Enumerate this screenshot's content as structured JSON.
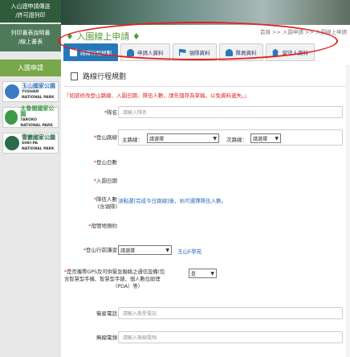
{
  "sidebar": {
    "top_links": [
      "入山證申請傳送",
      "/許可證列印"
    ],
    "links": [
      "列印書表說明書",
      "/線上書表"
    ],
    "apply_label": "入園申請",
    "parks": [
      {
        "zh": "玉山國家公園",
        "en1": "YUSHAN",
        "en2": "NATIONAL PARK",
        "color": "#3d7ac4"
      },
      {
        "zh": "太魯閣國家公園",
        "en1": "TAROKO",
        "en2": "NATIONAL PARK",
        "color": "#3c9a4a"
      },
      {
        "zh": "雪霸國家公園",
        "en1": "SHEI-PA",
        "en2": "NATIONAL PARK",
        "color": "#2b6a4a"
      }
    ]
  },
  "header": {
    "title": "入園線上申請",
    "breadcrumb": "首頁 >> 入園申請 >> 入園線上申請"
  },
  "tabs": [
    {
      "label": "路線行程規劃",
      "icon": "schedule-icon"
    },
    {
      "label": "申請人資料",
      "icon": "person-icon"
    },
    {
      "label": "領隊資料",
      "icon": "flag-icon"
    },
    {
      "label": "隊員資料",
      "icon": "group-icon"
    },
    {
      "label": "留守人資料",
      "icon": "home-icon"
    }
  ],
  "section": {
    "title": "路線行程規劃",
    "warning": "『如欲修改登山路線、入園日期、隊伍人數，請先儲存為草稿，以免資料遺失。』"
  },
  "form": {
    "team_name_label": "隊名",
    "team_name_placeholder": "請輸入隊名",
    "route_label": "登山路線",
    "main_route_label": "主路線：",
    "main_route_value": "請選擇",
    "sub_route_label": "次路線：",
    "sub_route_value": "請選擇",
    "climb_days_label": "登山日數",
    "entry_date_label": "入園日期",
    "team_size_label": "隊伍人數",
    "team_size_sub": "(含領隊)",
    "team_size_note": "須點選[完成今日路線]後，始可選擇隊伍人數。",
    "camp_label": "宿營地預約",
    "pre_training_label": "登山行前講習",
    "pre_training_value": "請選擇",
    "pre_training_link": "玉山E學苑",
    "gps_label_1": "是否攜帶GPS及可供緊急聯絡之通信設備(包",
    "gps_label_2": "含智慧型手機、智慧型手錶、個人數位助理",
    "gps_label_3": "（PDA）等）",
    "gps_value": "是",
    "satellite_label": "衛星電話",
    "satellite_placeholder": "請輸入衛星電話",
    "radio_label": "無線電頻",
    "radio_placeholder": "請輸入無線電頻"
  }
}
